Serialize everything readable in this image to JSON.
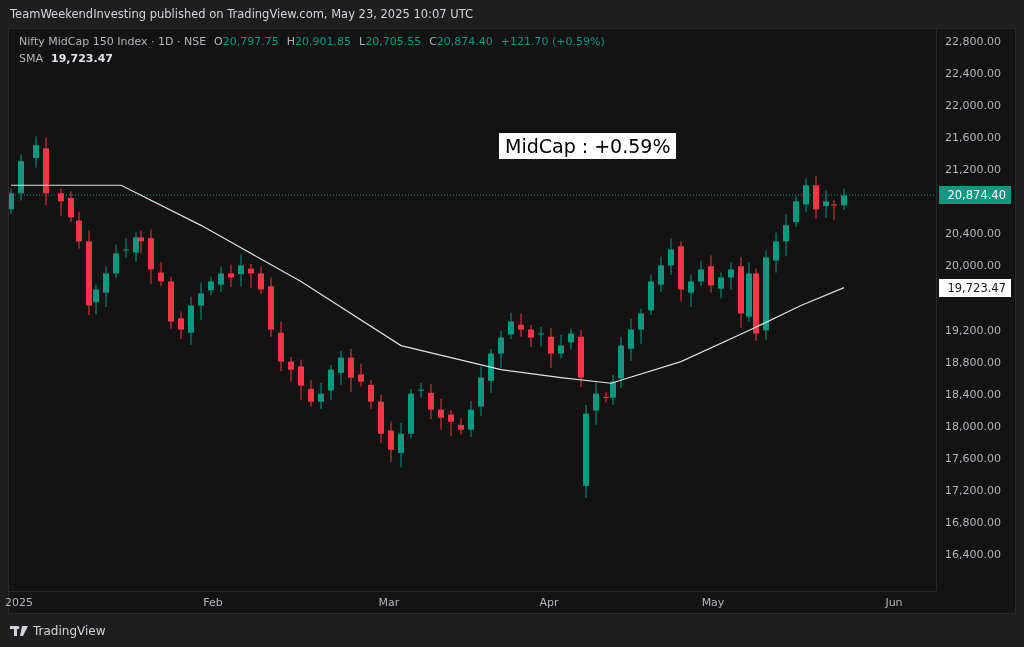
{
  "header": {
    "published": "TeamWeekendInvesting published on TradingView.com, May 23, 2025 10:07 UTC"
  },
  "legend": {
    "symbol": "Nifty MidCap 150 Index · 1D · NSE",
    "ohlc": [
      {
        "label": "O",
        "value": "20,797.75"
      },
      {
        "label": "H",
        "value": "20,901.85"
      },
      {
        "label": "L",
        "value": "20,705.55"
      },
      {
        "label": "C",
        "value": "20,874.40"
      }
    ],
    "change": "+121.70 (+0.59%)",
    "indicator": {
      "label": "SMA",
      "value": "19,723.47"
    }
  },
  "annotation": {
    "text": "MidCap : +0.59%"
  },
  "price_axis": {
    "ticks": [
      "22,800.00",
      "22,400.00",
      "22,000.00",
      "21,600.00",
      "21,200.00",
      "20,400.00",
      "20,000.00",
      "19,200.00",
      "18,800.00",
      "18,400.00",
      "18,000.00",
      "17,600.00",
      "17,200.00",
      "16,800.00",
      "16,400.00"
    ],
    "labels": [
      {
        "kind": "last",
        "text": "20,874.40"
      },
      {
        "kind": "sma",
        "text": "19,723.47"
      }
    ]
  },
  "time_axis": {
    "labels": [
      "2025",
      "Feb",
      "Mar",
      "Apr",
      "May",
      "Jun"
    ]
  },
  "footer": {
    "brand": "TradingView"
  }
}
